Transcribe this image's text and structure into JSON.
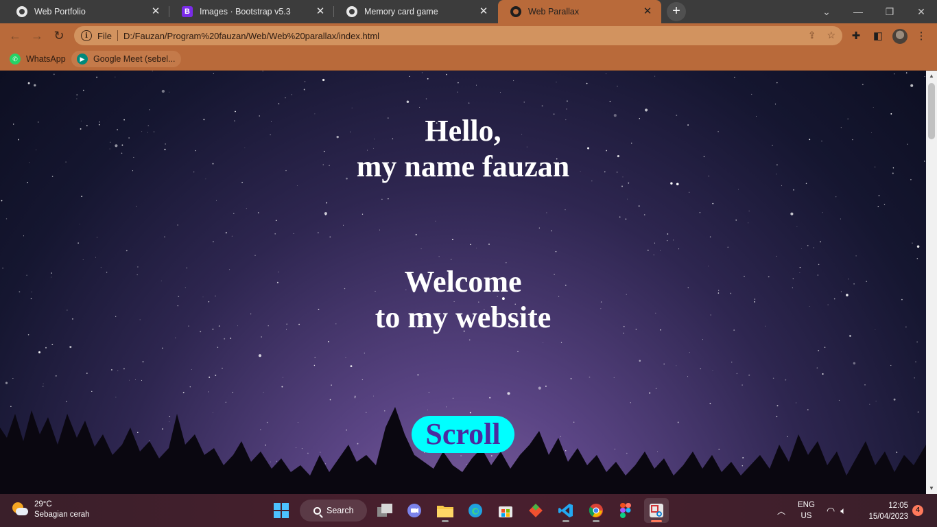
{
  "browser": {
    "tabs": [
      {
        "label": "Web Portfolio",
        "active": false,
        "favicon": "globe-icon"
      },
      {
        "label": "Images · Bootstrap v5.3",
        "active": false,
        "favicon": "bootstrap-icon",
        "favicon_letter": "B"
      },
      {
        "label": "Memory card game",
        "active": false,
        "favicon": "globe-icon"
      },
      {
        "label": "Web Parallax",
        "active": true,
        "favicon": "globe-icon"
      }
    ],
    "new_tab_symbol": "+",
    "address_bar": {
      "scheme_label": "File",
      "url": "D:/Fauzan/Program%20fauzan/Web/Web%20parallax/index.html"
    },
    "bookmarks": [
      {
        "label": "WhatsApp",
        "icon": "whatsapp-icon"
      },
      {
        "label": "Google Meet (sebel...",
        "icon": "google-meet-icon"
      }
    ],
    "theme_color": "#b96a3a"
  },
  "page": {
    "greeting_line1": "Hello,",
    "greeting_line2": "my name fauzan",
    "welcome_line1": "Welcome",
    "welcome_line2": "to my website",
    "scroll_button": "Scroll",
    "scroll_button_bg": "#00ffff",
    "scroll_button_text_color": "#4b2aa0"
  },
  "taskbar": {
    "weather_temp": "29°C",
    "weather_desc": "Sebagian cerah",
    "search_label": "Search",
    "language_line1": "ENG",
    "language_line2": "US",
    "time": "12:05",
    "date": "15/04/2023",
    "notification_count": "4",
    "apps": [
      "windows-start",
      "search",
      "task-view",
      "teams-chat",
      "file-explorer",
      "edge",
      "microsoft-store",
      "git",
      "vscode",
      "chrome",
      "figma",
      "snipping-tool"
    ]
  }
}
